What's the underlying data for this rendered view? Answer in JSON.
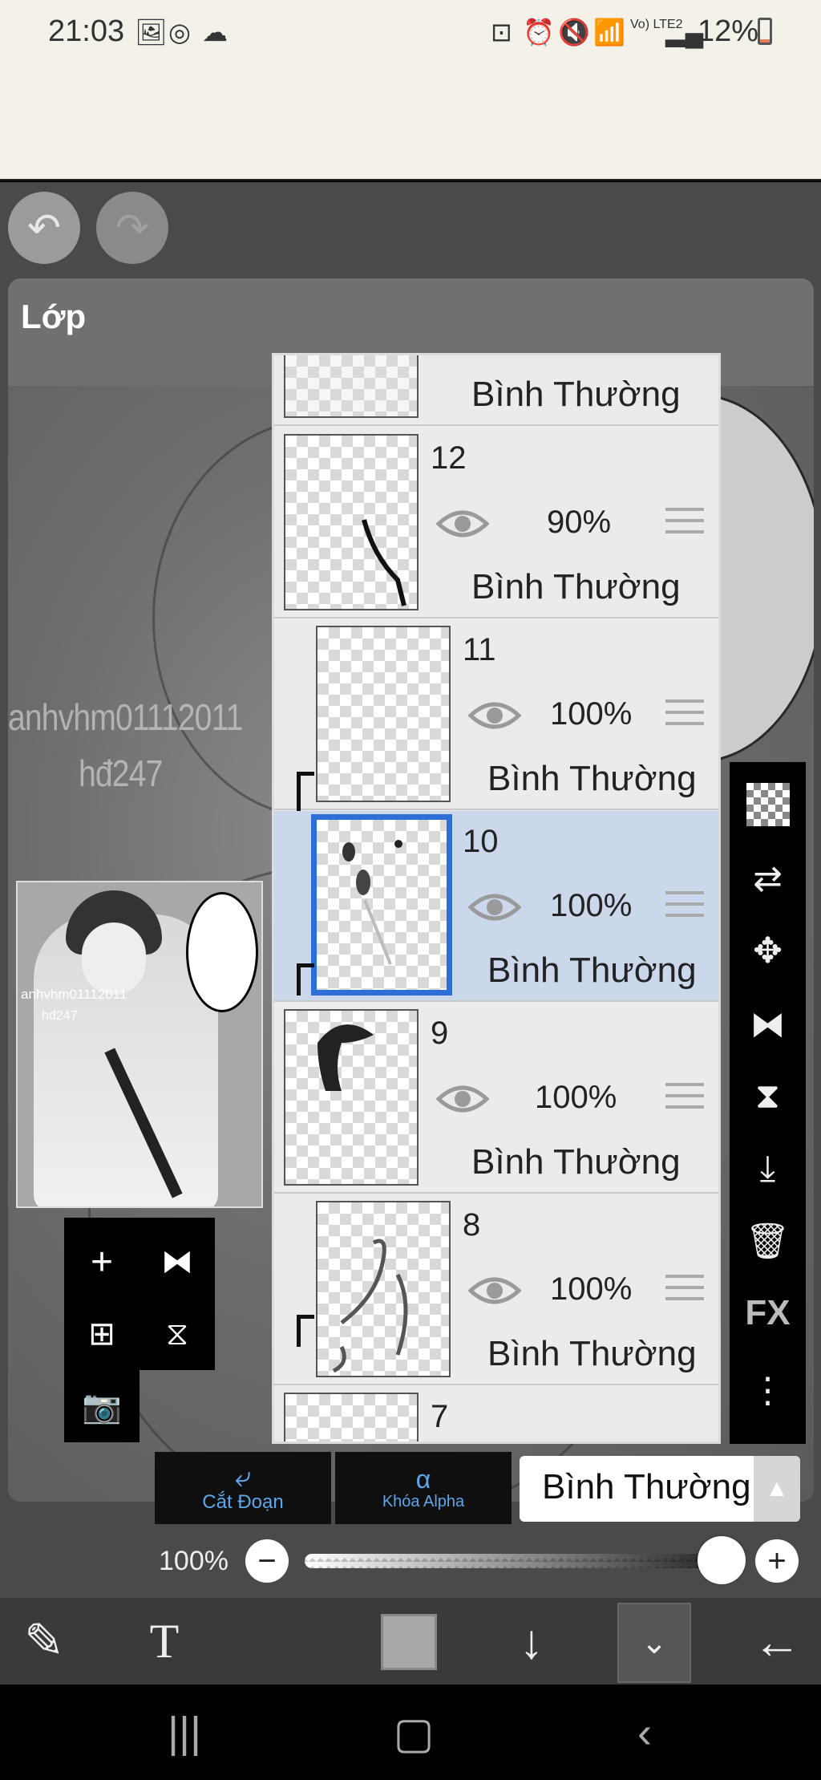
{
  "status_bar": {
    "time": "21:03",
    "battery": "12%",
    "network": "Vo) LTE2"
  },
  "panel": {
    "title": "Lớp"
  },
  "watermark": {
    "line1": "anhvhm01112011",
    "line2": "hđ247"
  },
  "layers": [
    {
      "number": "",
      "opacity": "",
      "blend": "Bình Thường",
      "visible": true,
      "clipped": false,
      "selected": false
    },
    {
      "number": "12",
      "opacity": "90%",
      "blend": "Bình Thường",
      "visible": true,
      "clipped": false,
      "selected": false
    },
    {
      "number": "11",
      "opacity": "100%",
      "blend": "Bình Thường",
      "visible": true,
      "clipped": true,
      "selected": false
    },
    {
      "number": "10",
      "opacity": "100%",
      "blend": "Bình Thường",
      "visible": true,
      "clipped": true,
      "selected": true
    },
    {
      "number": "9",
      "opacity": "100%",
      "blend": "Bình Thường",
      "visible": true,
      "clipped": false,
      "selected": false
    },
    {
      "number": "8",
      "opacity": "100%",
      "blend": "Bình Thường",
      "visible": true,
      "clipped": true,
      "selected": false
    },
    {
      "number": "7",
      "opacity": "",
      "blend": "",
      "visible": true,
      "clipped": false,
      "selected": false
    }
  ],
  "right_tools": {
    "fx_label": "FX"
  },
  "blend_bar": {
    "clipping_label": "Cắt Đoạn",
    "alpha_lock_label": "Khóa Alpha",
    "blend_mode": "Bình Thường",
    "alpha_symbol": "α"
  },
  "opacity": {
    "value_label": "100%",
    "value": 1.0
  },
  "bottom_toolbar": {
    "text_tool_label": "T"
  },
  "colors": {
    "accent": "#2c6fd6",
    "selected_row": "#cbd8ec",
    "clipping_blue": "#5ba7ec",
    "color_swatch": "#a8a8a8"
  },
  "icons": {
    "undo": "undo-icon",
    "redo": "redo-icon",
    "add_layer": "plus-icon",
    "flip": "flip-horizontal-icon",
    "duplicate": "add-layer-icon",
    "merge": "merge-icon",
    "camera": "camera-icon",
    "transparency": "checkerboard-icon",
    "move": "move-icon",
    "delete": "trash-icon",
    "more": "more-vertical-icon"
  }
}
